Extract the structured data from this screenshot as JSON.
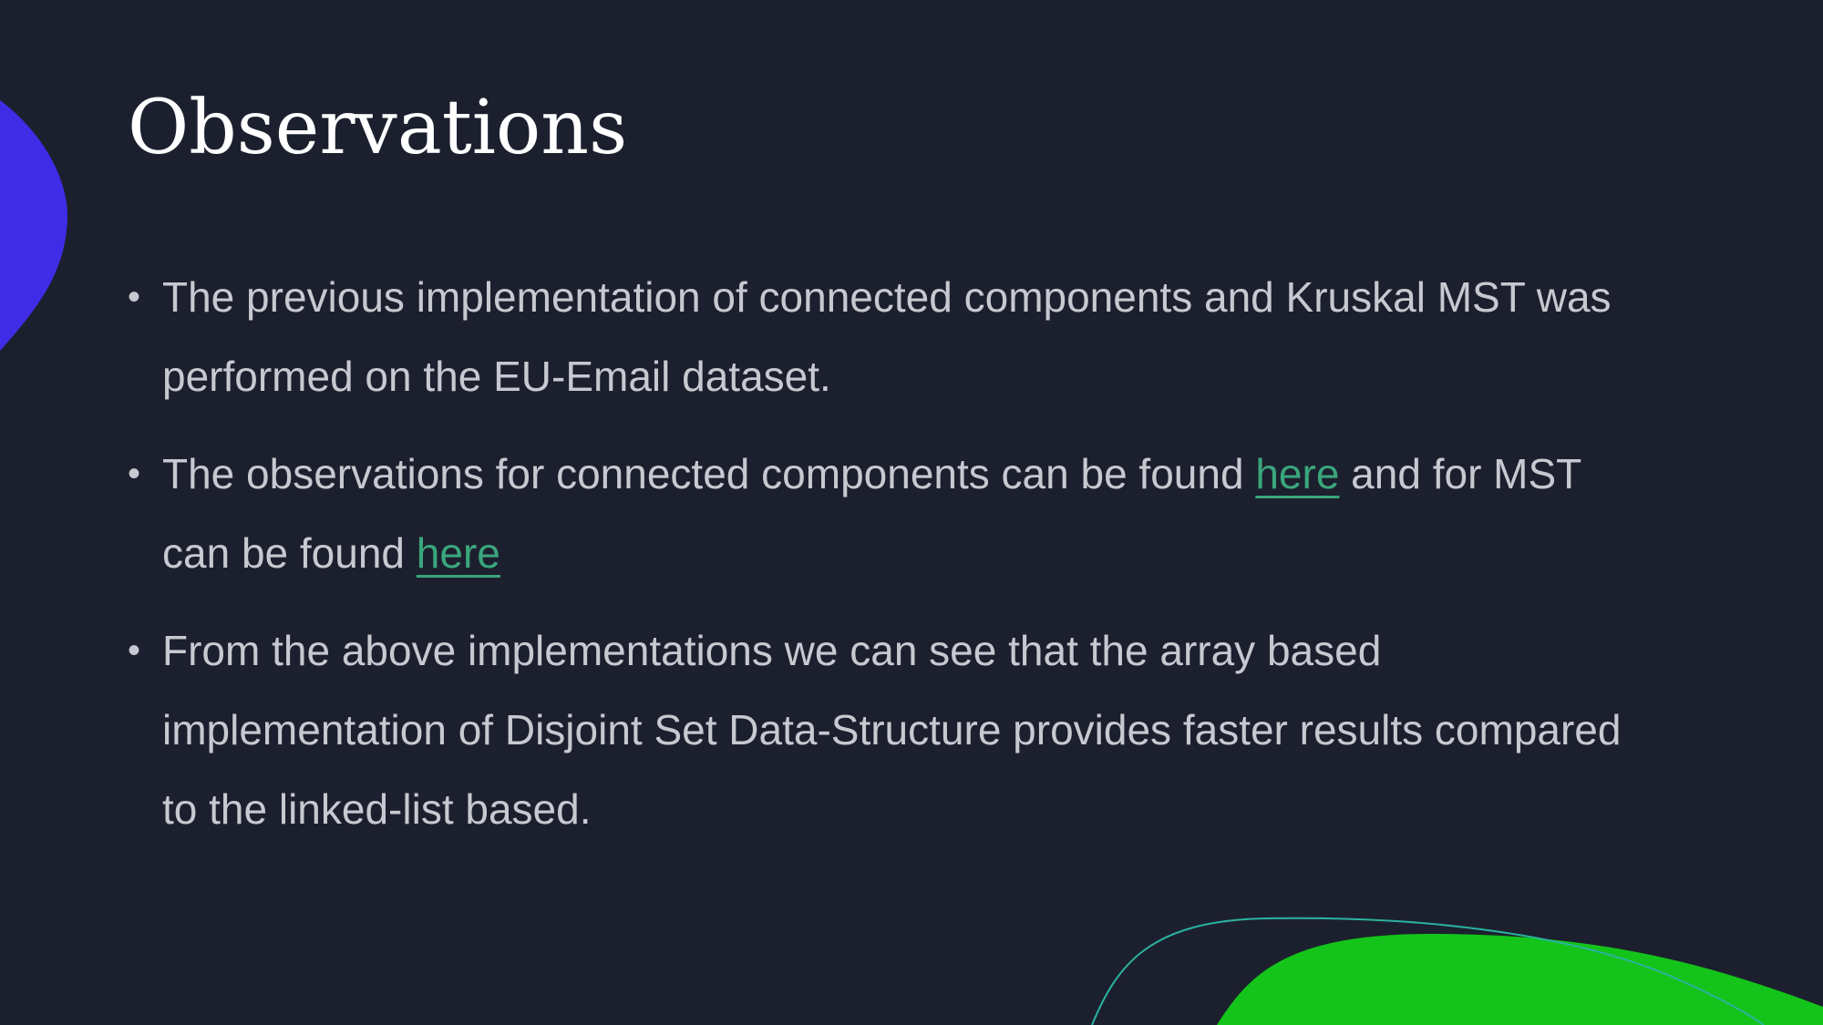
{
  "slide": {
    "title": "Observations",
    "bullets": [
      {
        "text": "The previous implementation of connected components and Kruskal MST was performed on the EU-Email dataset."
      },
      {
        "text_before": "The observations for connected components can be found ",
        "link1_label": "here",
        "text_middle": " and for MST can be found ",
        "link2_label": "here"
      },
      {
        "text": "From the above implementations we can see that the array based implementation of Disjoint Set Data-Structure provides faster results compared to the linked-list based."
      }
    ],
    "bullet_symbol": "•"
  },
  "colors": {
    "background": "#1c202e",
    "title": "#ffffff",
    "body_text": "#c7c9d1",
    "link": "#3aa67c",
    "blob_blue": "#3e2ce6",
    "blob_green": "#14c41a",
    "curve_teal": "#2bb3a0"
  }
}
